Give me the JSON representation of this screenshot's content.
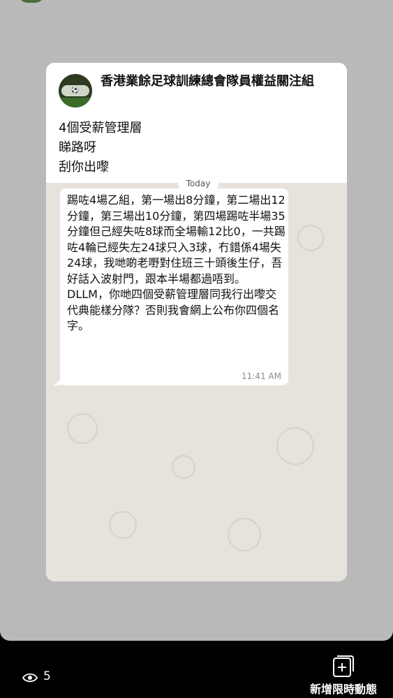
{
  "post": {
    "group_name": "香港業餘足球訓練總會隊員權益關注組",
    "avatar_label": "⚽",
    "lines": [
      "4個受薪管理層",
      "睇路呀",
      "刮你出嚟"
    ]
  },
  "chat": {
    "date_chip": "Today",
    "message_text": "踢咗4場乙組，第一場出8分鐘，第二場出12分鐘，第三場出10分鐘，第四場踢咗半場35分鐘但己經失咗8球而全場輸12比0，一共踢咗4輪已經失左24球只入3球，冇錯係4場失24球，我哋啲老嘢對住班三十頭後生仔，吾好話入波射門，跟本半場都過唔到。\nDLLM，你哋四個受薪管理層同我行出嚟交代典能樣分隊？否則我會網上公布你四個名字。",
    "message_time": "11:41 AM"
  },
  "footer": {
    "view_count": "5",
    "add_story_label": "新增限時動態"
  },
  "colors": {
    "story_bg": "#b9b9b9",
    "chat_bg": "#e7e3dc",
    "bubble": "#ffffff",
    "footer_bg": "#000000"
  }
}
